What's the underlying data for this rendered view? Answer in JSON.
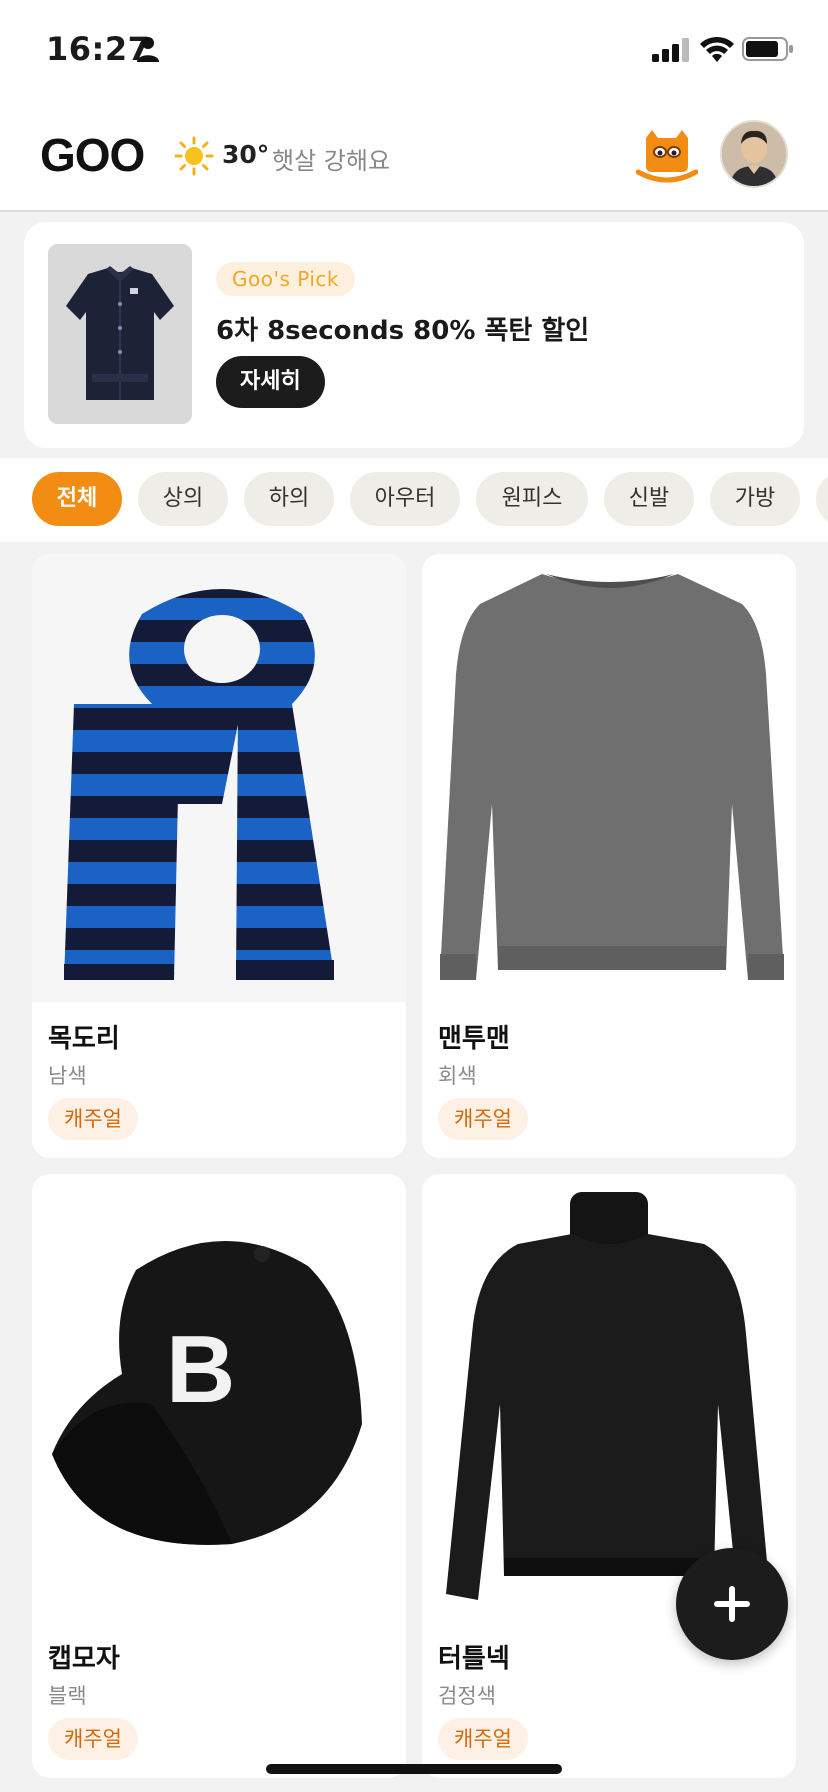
{
  "status_bar": {
    "time": "16:27"
  },
  "header": {
    "logo": "GOO",
    "weather": {
      "temp": "30°",
      "desc": "햇살 강해요",
      "icon": "sun-icon"
    }
  },
  "promo": {
    "badge": "Goo's Pick",
    "title": "6차 8seconds 80% 폭탄 할인",
    "button": "자세히"
  },
  "categories": [
    {
      "label": "전체",
      "active": true
    },
    {
      "label": "상의",
      "active": false
    },
    {
      "label": "하의",
      "active": false
    },
    {
      "label": "아우터",
      "active": false
    },
    {
      "label": "원피스",
      "active": false
    },
    {
      "label": "신발",
      "active": false
    },
    {
      "label": "가방",
      "active": false
    }
  ],
  "products": [
    {
      "name": "목도리",
      "color": "남색",
      "tag": "캐주얼",
      "icon": "striped-scarf-image"
    },
    {
      "name": "맨투맨",
      "color": "회색",
      "tag": "캐주얼",
      "icon": "gray-sweatshirt-image"
    },
    {
      "name": "캡모자",
      "color": "블랙",
      "tag": "캐주얼",
      "icon": "black-cap-image"
    },
    {
      "name": "터틀넥",
      "color": "검정색",
      "tag": "캐주얼",
      "icon": "black-turtleneck-image"
    }
  ],
  "colors": {
    "accent": "#f28c12",
    "badge_text": "#f5a623",
    "tag_text": "#d46a0c",
    "tag_bg": "#fdf0e4"
  }
}
